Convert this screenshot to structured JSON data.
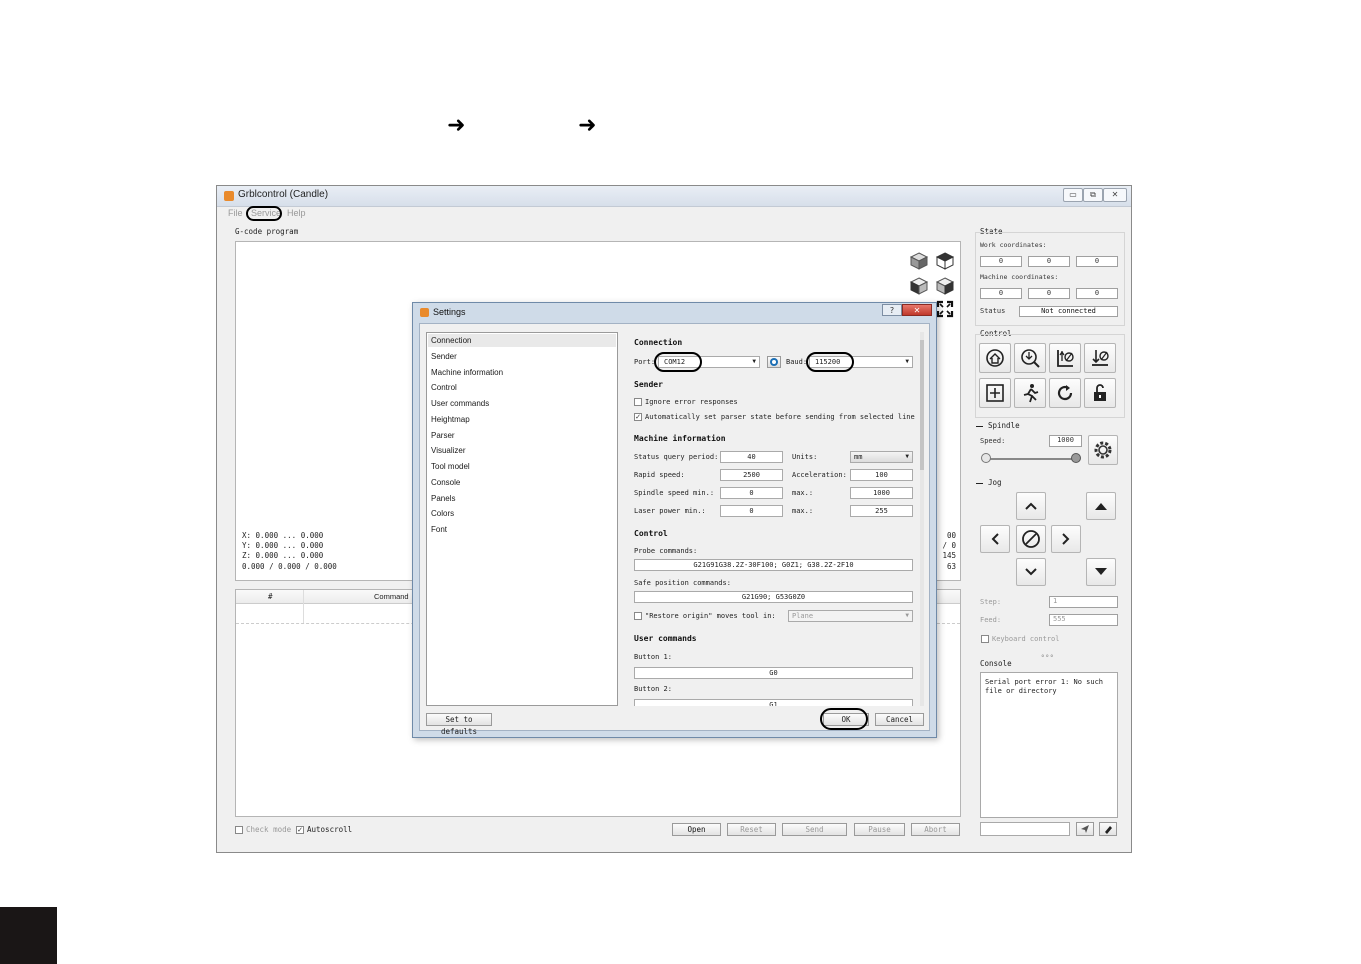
{
  "page": {
    "arrow_1": "➜",
    "arrow_2": "➜"
  },
  "window": {
    "title": "Grblcontrol (Candle)",
    "minimize": "▭",
    "maximize": "⧉",
    "close": "✕",
    "menu": [
      "File",
      "Service",
      "Help"
    ]
  },
  "gcode": {
    "group_title": "G-code program",
    "coords": [
      "X: 0.000 ... 0.000",
      "Y: 0.000 ... 0.000",
      "Z: 0.000 ... 0.000",
      "0.000 / 0.000 / 0.000"
    ],
    "right_partial": [
      "00",
      "/ 0",
      "145",
      "63"
    ]
  },
  "table": {
    "columns": [
      "#",
      "Command"
    ]
  },
  "bottom": {
    "check_mode": "Check mode",
    "autoscroll": "Autoscroll",
    "open": "Open",
    "reset": "Reset",
    "send": "Send",
    "pause": "Pause",
    "abort": "Abort"
  },
  "state": {
    "title": "State",
    "work_label": "Work coordinates:",
    "work": [
      "0",
      "0",
      "0"
    ],
    "machine_label": "Machine coordinates:",
    "machine": [
      "0",
      "0",
      "0"
    ],
    "status_label": "Status",
    "status_value": "Not connected"
  },
  "control": {
    "title": "Control"
  },
  "spindle": {
    "title": "Spindle",
    "speed_label": "Speed:",
    "speed_value": "1000"
  },
  "jog": {
    "title": "Jog",
    "step_label": "Step:",
    "step_value": "1",
    "feed_label": "Feed:",
    "feed_value": "555",
    "keyboard": "Keyboard control"
  },
  "console": {
    "title": "Console",
    "text": "Serial port error 1: No such file or directory"
  },
  "settings": {
    "title": "Settings",
    "help": "?",
    "close": "✕",
    "nav": [
      "Connection",
      "Sender",
      "Machine information",
      "Control",
      "User commands",
      "Heightmap",
      "Parser",
      "Visualizer",
      "Tool model",
      "Console",
      "Panels",
      "Colors",
      "Font"
    ],
    "connection": {
      "title": "Connection",
      "port_label": "Port:",
      "port_value": "COM12",
      "baud_label": "Baud:",
      "baud_value": "115200"
    },
    "sender": {
      "title": "Sender",
      "ignore": "Ignore error responses",
      "auto": "Automatically set parser state before sending from selected line"
    },
    "machine": {
      "title": "Machine information",
      "status_query_label": "Status query period:",
      "status_query_value": "40",
      "units_label": "Units:",
      "units_value": "mm",
      "rapid_label": "Rapid speed:",
      "rapid_value": "2500",
      "accel_label": "Acceleration:",
      "accel_value": "100",
      "spindle_min_label": "Spindle speed min.:",
      "spindle_min_value": "0",
      "spindle_max_label": "max.:",
      "spindle_max_value": "1000",
      "laser_min_label": "Laser power min.:",
      "laser_min_value": "0",
      "laser_max_label": "max.:",
      "laser_max_value": "255"
    },
    "control": {
      "title": "Control",
      "probe_label": "Probe commands:",
      "probe_value": "G21G91G38.2Z-30F100; G0Z1; G38.2Z-2F10",
      "safe_label": "Safe position commands:",
      "safe_value": "G21G90; G53G0Z0",
      "restore_label": "\"Restore origin\" moves tool in:",
      "restore_value": "Plane"
    },
    "user": {
      "title": "User commands",
      "b1_label": "Button 1:",
      "b1_value": "G0",
      "b2_label": "Button 2:",
      "b2_value": "G1"
    },
    "defaults": "Set to defaults",
    "ok": "OK",
    "cancel": "Cancel"
  }
}
